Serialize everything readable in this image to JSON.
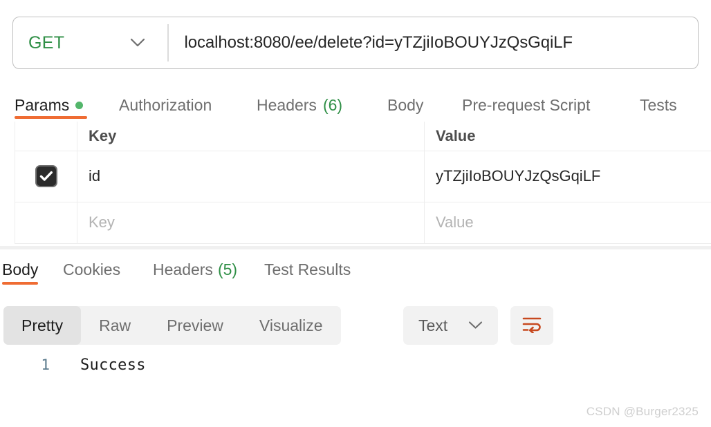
{
  "request": {
    "method": "GET",
    "method_color": "#2f8f46",
    "url": "localhost:8080/ee/delete?id=yTZjiIoBOUYJzQsGqiLF",
    "method_caret_icon": "chevron-down-icon",
    "tabs": [
      {
        "label": "Params",
        "badge": "",
        "dot": true,
        "active": true
      },
      {
        "label": "Authorization",
        "badge": "",
        "dot": false,
        "active": false
      },
      {
        "label": "Headers",
        "badge": "(6)",
        "dot": false,
        "active": false
      },
      {
        "label": "Body",
        "badge": "",
        "dot": false,
        "active": false
      },
      {
        "label": "Pre-request Script",
        "badge": "",
        "dot": false,
        "active": false
      },
      {
        "label": "Tests",
        "badge": "",
        "dot": false,
        "active": false
      }
    ]
  },
  "params_table": {
    "headers": {
      "key": "Key",
      "value": "Value"
    },
    "rows": [
      {
        "enabled": true,
        "key": "id",
        "value": "yTZjiIoBOUYJzQsGqiLF"
      }
    ],
    "empty_row": {
      "key_placeholder": "Key",
      "value_placeholder": "Value"
    }
  },
  "response": {
    "tabs": [
      {
        "label": "Body",
        "badge": "",
        "active": true
      },
      {
        "label": "Cookies",
        "badge": "",
        "active": false
      },
      {
        "label": "Headers",
        "badge": "(5)",
        "active": false
      },
      {
        "label": "Test Results",
        "badge": "",
        "active": false
      }
    ],
    "view_modes": [
      {
        "label": "Pretty",
        "active": true
      },
      {
        "label": "Raw",
        "active": false
      },
      {
        "label": "Preview",
        "active": false
      },
      {
        "label": "Visualize",
        "active": false
      }
    ],
    "format": {
      "label": "Text",
      "caret_icon": "chevron-down-icon"
    },
    "wrap_button": {
      "icon": "word-wrap-icon",
      "color": "#c7491f"
    },
    "body": {
      "lines": [
        {
          "number": "1",
          "text": "Success"
        }
      ]
    }
  },
  "colors": {
    "accent_orange": "#ef6c33",
    "green": "#2f8f46",
    "wrap_orange": "#c7491f"
  },
  "watermark": "CSDN @Burger2325"
}
